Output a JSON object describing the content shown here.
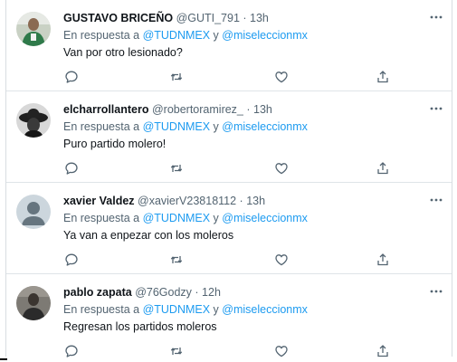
{
  "colors": {
    "accent": "#1d9bf0",
    "text": "#0f1419",
    "secondary": "#536471"
  },
  "tweets": [
    {
      "name": "GUSTAVO BRICEÑO",
      "handle": "@GUTI_791",
      "separator": " · ",
      "time": "13h",
      "reply_prefix": "En respuesta a ",
      "mention1": "@TUDNMEX",
      "reply_joiner": " y ",
      "mention2": "@miseleccionmx",
      "text": "Van por otro lesionado?"
    },
    {
      "name": "elcharrollantero",
      "handle": "@robertoramirez_",
      "separator": " · ",
      "time": "13h",
      "reply_prefix": "En respuesta a ",
      "mention1": "@TUDNMEX",
      "reply_joiner": " y ",
      "mention2": "@miseleccionmx",
      "text": "Puro partido molero!"
    },
    {
      "name": "xavier Valdez",
      "handle": "@xavierV23818112",
      "separator": " · ",
      "time": "13h",
      "reply_prefix": "En respuesta a ",
      "mention1": "@TUDNMEX",
      "reply_joiner": " y ",
      "mention2": "@miseleccionmx",
      "text": "Ya van a enpezar con los moleros"
    },
    {
      "name": "pablo zapata",
      "handle": "@76Godzy",
      "separator": " · ",
      "time": "12h",
      "reply_prefix": "En respuesta a ",
      "mention1": "@TUDNMEX",
      "reply_joiner": " y ",
      "mention2": "@miseleccionmx",
      "text": "Regresan los partidos moleros"
    }
  ]
}
